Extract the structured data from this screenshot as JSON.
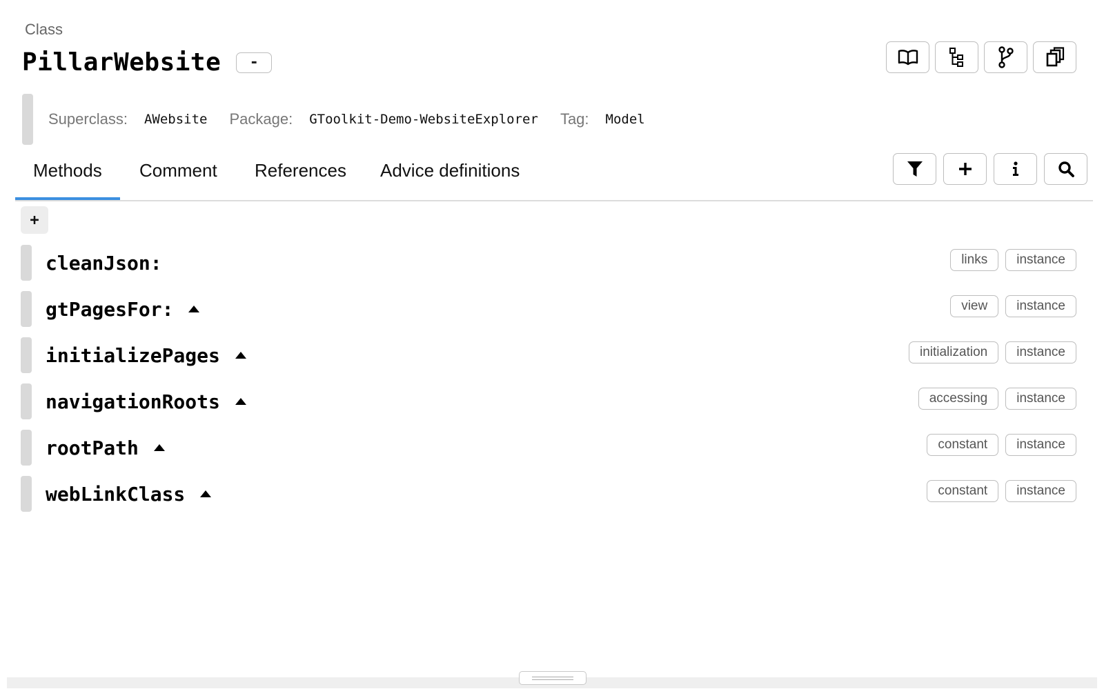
{
  "header": {
    "kind": "Class",
    "title": "PillarWebsite",
    "collapse_label": "-",
    "actions": [
      {
        "icon": "book-icon"
      },
      {
        "icon": "hierarchy-icon"
      },
      {
        "icon": "branch-icon"
      },
      {
        "icon": "copy-icon"
      }
    ]
  },
  "meta": {
    "superclass_label": "Superclass:",
    "superclass": "AWebsite",
    "package_label": "Package:",
    "package": "GToolkit-Demo-WebsiteExplorer",
    "tag_label": "Tag:",
    "tag": "Model"
  },
  "tabs": [
    {
      "label": "Methods",
      "active": true
    },
    {
      "label": "Comment",
      "active": false
    },
    {
      "label": "References",
      "active": false
    },
    {
      "label": "Advice definitions",
      "active": false
    }
  ],
  "tab_actions": [
    {
      "icon": "filter-icon"
    },
    {
      "icon": "plus-icon"
    },
    {
      "icon": "info-icon"
    },
    {
      "icon": "search-icon"
    }
  ],
  "add_method_label": "+",
  "methods": [
    {
      "name": "cleanJson:",
      "expandable": false,
      "tags": [
        "links",
        "instance"
      ]
    },
    {
      "name": "gtPagesFor:",
      "expandable": true,
      "tags": [
        "view",
        "instance"
      ]
    },
    {
      "name": "initializePages",
      "expandable": true,
      "tags": [
        "initialization",
        "instance"
      ]
    },
    {
      "name": "navigationRoots",
      "expandable": true,
      "tags": [
        "accessing",
        "instance"
      ]
    },
    {
      "name": "rootPath",
      "expandable": true,
      "tags": [
        "constant",
        "instance"
      ]
    },
    {
      "name": "webLinkClass",
      "expandable": true,
      "tags": [
        "constant",
        "instance"
      ]
    }
  ],
  "colors": {
    "accent": "#3b8fe0",
    "strip": "#d9d9d9",
    "border": "#bdbdbd"
  }
}
